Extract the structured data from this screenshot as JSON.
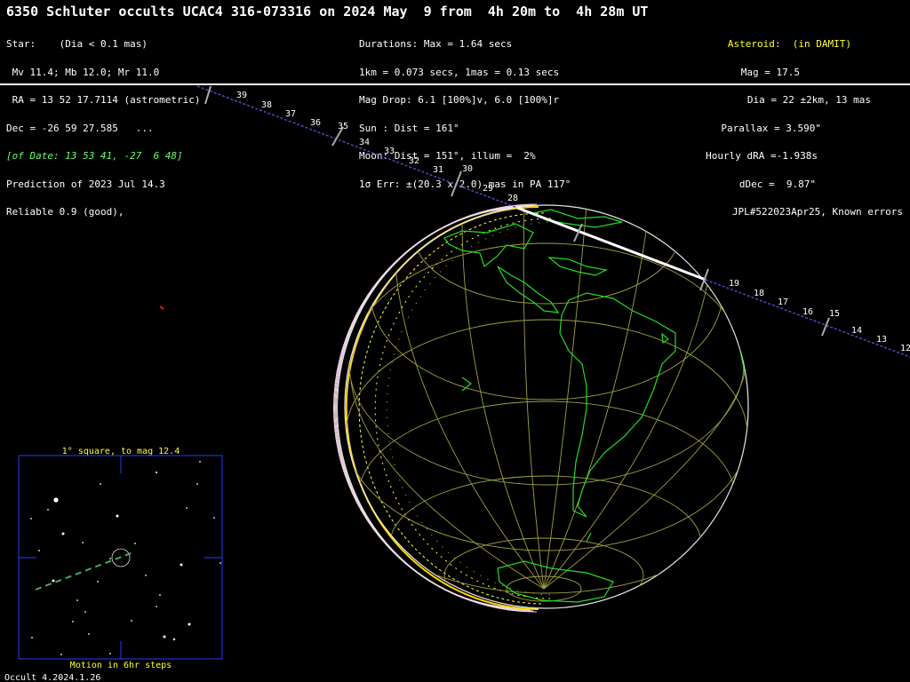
{
  "header": {
    "title": "6350 Schluter occults UCAC4 316-073316 on 2024 May  9 from  4h 20m to  4h 28m UT"
  },
  "star_block": {
    "lines": [
      "Star:    (Dia < 0.1 mas)",
      " Mv 11.4; Mb 12.0; Mr 11.0",
      " RA = 13 52 17.7114 (astrometric)",
      "Dec = -26 59 27.585   ...",
      "[of Date: 13 53 41, -27  6 48]",
      "Prediction of 2023 Jul 14.3",
      "Reliable 0.9 (good),"
    ]
  },
  "event_block": {
    "lines": [
      "Durations: Max = 1.64 secs",
      "1km = 0.073 secs, 1mas = 0.13 secs",
      "Mag Drop: 6.1 [100%]v, 6.0 [100%]r",
      "Sun : Dist = 161°",
      "Moon: Dist = 151°, illum =  2%",
      "1σ Err: ±(20.3 x 2.0) mas in PA 117°"
    ]
  },
  "asteroid_block": {
    "heading": "Asteroid:  (in DAMIT)",
    "lines": [
      "Mag = 17.5",
      "Dia = 22 ±2km, 13 mas",
      "Parallax = 3.590\"",
      "Hourly dRA =-1.938s",
      "dDec =  9.87\"",
      "JPL#522023Apr25, Known errors"
    ]
  },
  "track_labels": {
    "upper": [
      "39",
      "38",
      "37",
      "36",
      "35",
      "34",
      "33",
      "32",
      "31",
      "30",
      "29",
      "28"
    ],
    "lower": [
      "19",
      "18",
      "17",
      "16",
      "15",
      "14",
      "13",
      "12"
    ]
  },
  "finder": {
    "title": "1° square, to mag 12.4",
    "caption": "Motion in 6hr steps"
  },
  "footer": {
    "version": "Occult 4.2024.1.26"
  },
  "colors": {
    "coast": "#22dd22",
    "grid": "#a0a040",
    "track": "#6a3cc0",
    "path": "#ffffff",
    "finder_frame": "#2233cc"
  }
}
